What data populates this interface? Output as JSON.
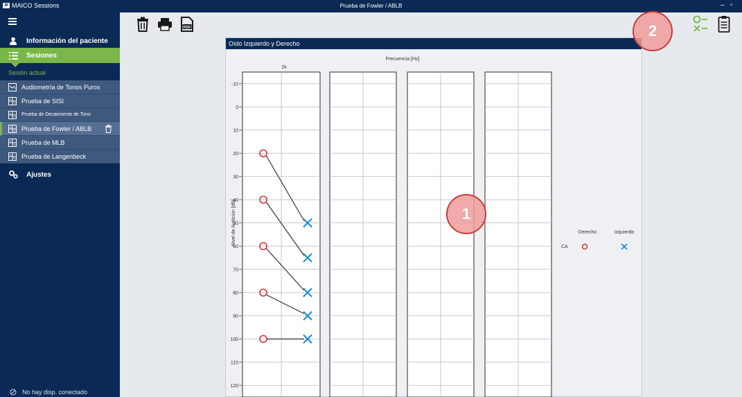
{
  "titlebar": {
    "brand_mark": "M",
    "app_name": "MAICO Sessions",
    "window_title": "Prueba de Fowler / ABLB",
    "minimize_glyph": "–",
    "maximize_glyph": "▫"
  },
  "sidebar": {
    "patient_label": "Información del paciente",
    "sessions_label": "Sesiones",
    "current_session_label": "Sesión actual",
    "items": [
      {
        "label": "Audiometría de Tonos Puros",
        "icon": "audiogram-icon",
        "active": false
      },
      {
        "label": "Prueba de SISI",
        "icon": "grid-chart-icon",
        "active": false
      },
      {
        "label": "Prueba de Decaimiento de Tono",
        "icon": "grid-chart-icon",
        "active": false,
        "small": true
      },
      {
        "label": "Prueba de Fowler / ABLB",
        "icon": "grid-chart-icon",
        "active": true
      },
      {
        "label": "Prueba de MLB",
        "icon": "grid-chart-icon",
        "active": false
      },
      {
        "label": "Prueba de Langenbeck",
        "icon": "grid-chart-icon",
        "active": false
      }
    ],
    "settings_label": "Ajustes",
    "status_text": "No hay disp. conectado"
  },
  "toolbar": {
    "icons": [
      "trash-icon",
      "print-icon",
      "pdf-icon"
    ],
    "right_icons": [
      "checklist-icon",
      "clipboard-icon"
    ]
  },
  "panel": {
    "title": "Oído Izquierdo y Derecho"
  },
  "colors": {
    "navy": "#0a2a55",
    "green": "#7ab648",
    "right_ear": "#d0363a",
    "left_ear": "#1d8ad6"
  },
  "chart_data": {
    "type": "scatter",
    "title": "Frecuencia [Hz]",
    "ylabel": "Nivel de Audición [dB]",
    "frequency_label": "2k",
    "y_ticks": [
      -10,
      0,
      10,
      20,
      30,
      40,
      50,
      60,
      70,
      80,
      90,
      100,
      110,
      120
    ],
    "ylim": [
      -15,
      125
    ],
    "inverted_y": true,
    "grid": true,
    "pairs": [
      {
        "right_db": 20,
        "left_db": 50
      },
      {
        "right_db": 40,
        "left_db": 65
      },
      {
        "right_db": 60,
        "left_db": 80
      },
      {
        "right_db": 80,
        "left_db": 90
      },
      {
        "right_db": 100,
        "left_db": 100
      }
    ],
    "legend": {
      "placement": "right",
      "row_label": "CA",
      "right_label": "Derecho",
      "left_label": "Izquierdo"
    }
  },
  "callouts": [
    "1",
    "2"
  ]
}
